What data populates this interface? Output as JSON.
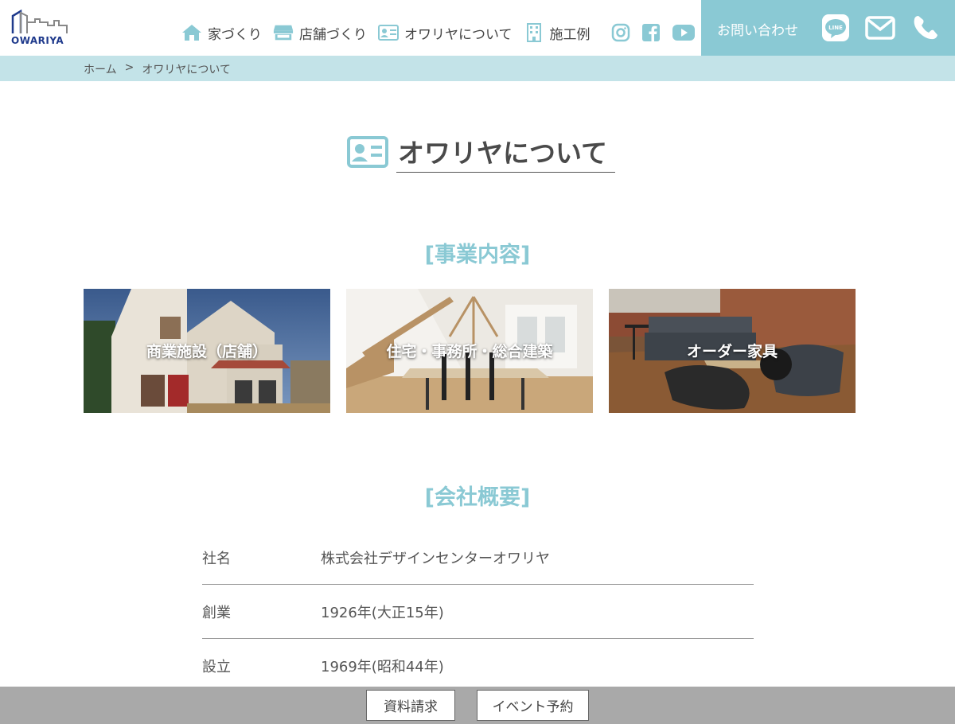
{
  "logo": {
    "text": "OWARIYA"
  },
  "nav": {
    "items": [
      {
        "label": "家づくり",
        "icon": "home-icon"
      },
      {
        "label": "店舗づくり",
        "icon": "shop-icon"
      },
      {
        "label": "オワリヤについて",
        "icon": "id-card-icon"
      },
      {
        "label": "施工例",
        "icon": "building-icon"
      }
    ],
    "social": [
      "instagram-icon",
      "facebook-icon",
      "youtube-icon"
    ]
  },
  "contact": {
    "label": "お問い合わせ",
    "icons": [
      "line-icon",
      "mail-icon",
      "phone-icon"
    ]
  },
  "breadcrumb": {
    "home": "ホーム",
    "separator": ">",
    "current": "オワリヤについて"
  },
  "page": {
    "title": "オワリヤについて"
  },
  "business": {
    "title": "[事業内容]",
    "cards": [
      {
        "label": "商業施設（店舗）"
      },
      {
        "label": "住宅・事務所・総合建築"
      },
      {
        "label": "オーダー家具"
      }
    ]
  },
  "company": {
    "title": "[会社概要]",
    "rows": [
      {
        "key": "社名",
        "value": "株式会社デザインセンターオワリヤ"
      },
      {
        "key": "創業",
        "value": "1926年(大正15年)"
      },
      {
        "key": "設立",
        "value": "1969年(昭和44年)"
      }
    ]
  },
  "footer": {
    "buttons": [
      {
        "label": "資料請求"
      },
      {
        "label": "イベント予約"
      }
    ]
  },
  "colors": {
    "accent": "#8ac9d4",
    "breadcrumb_bg": "#c3e3e8",
    "footer_bg": "#a9a9a9",
    "logo_blue": "#1f3a8c"
  }
}
